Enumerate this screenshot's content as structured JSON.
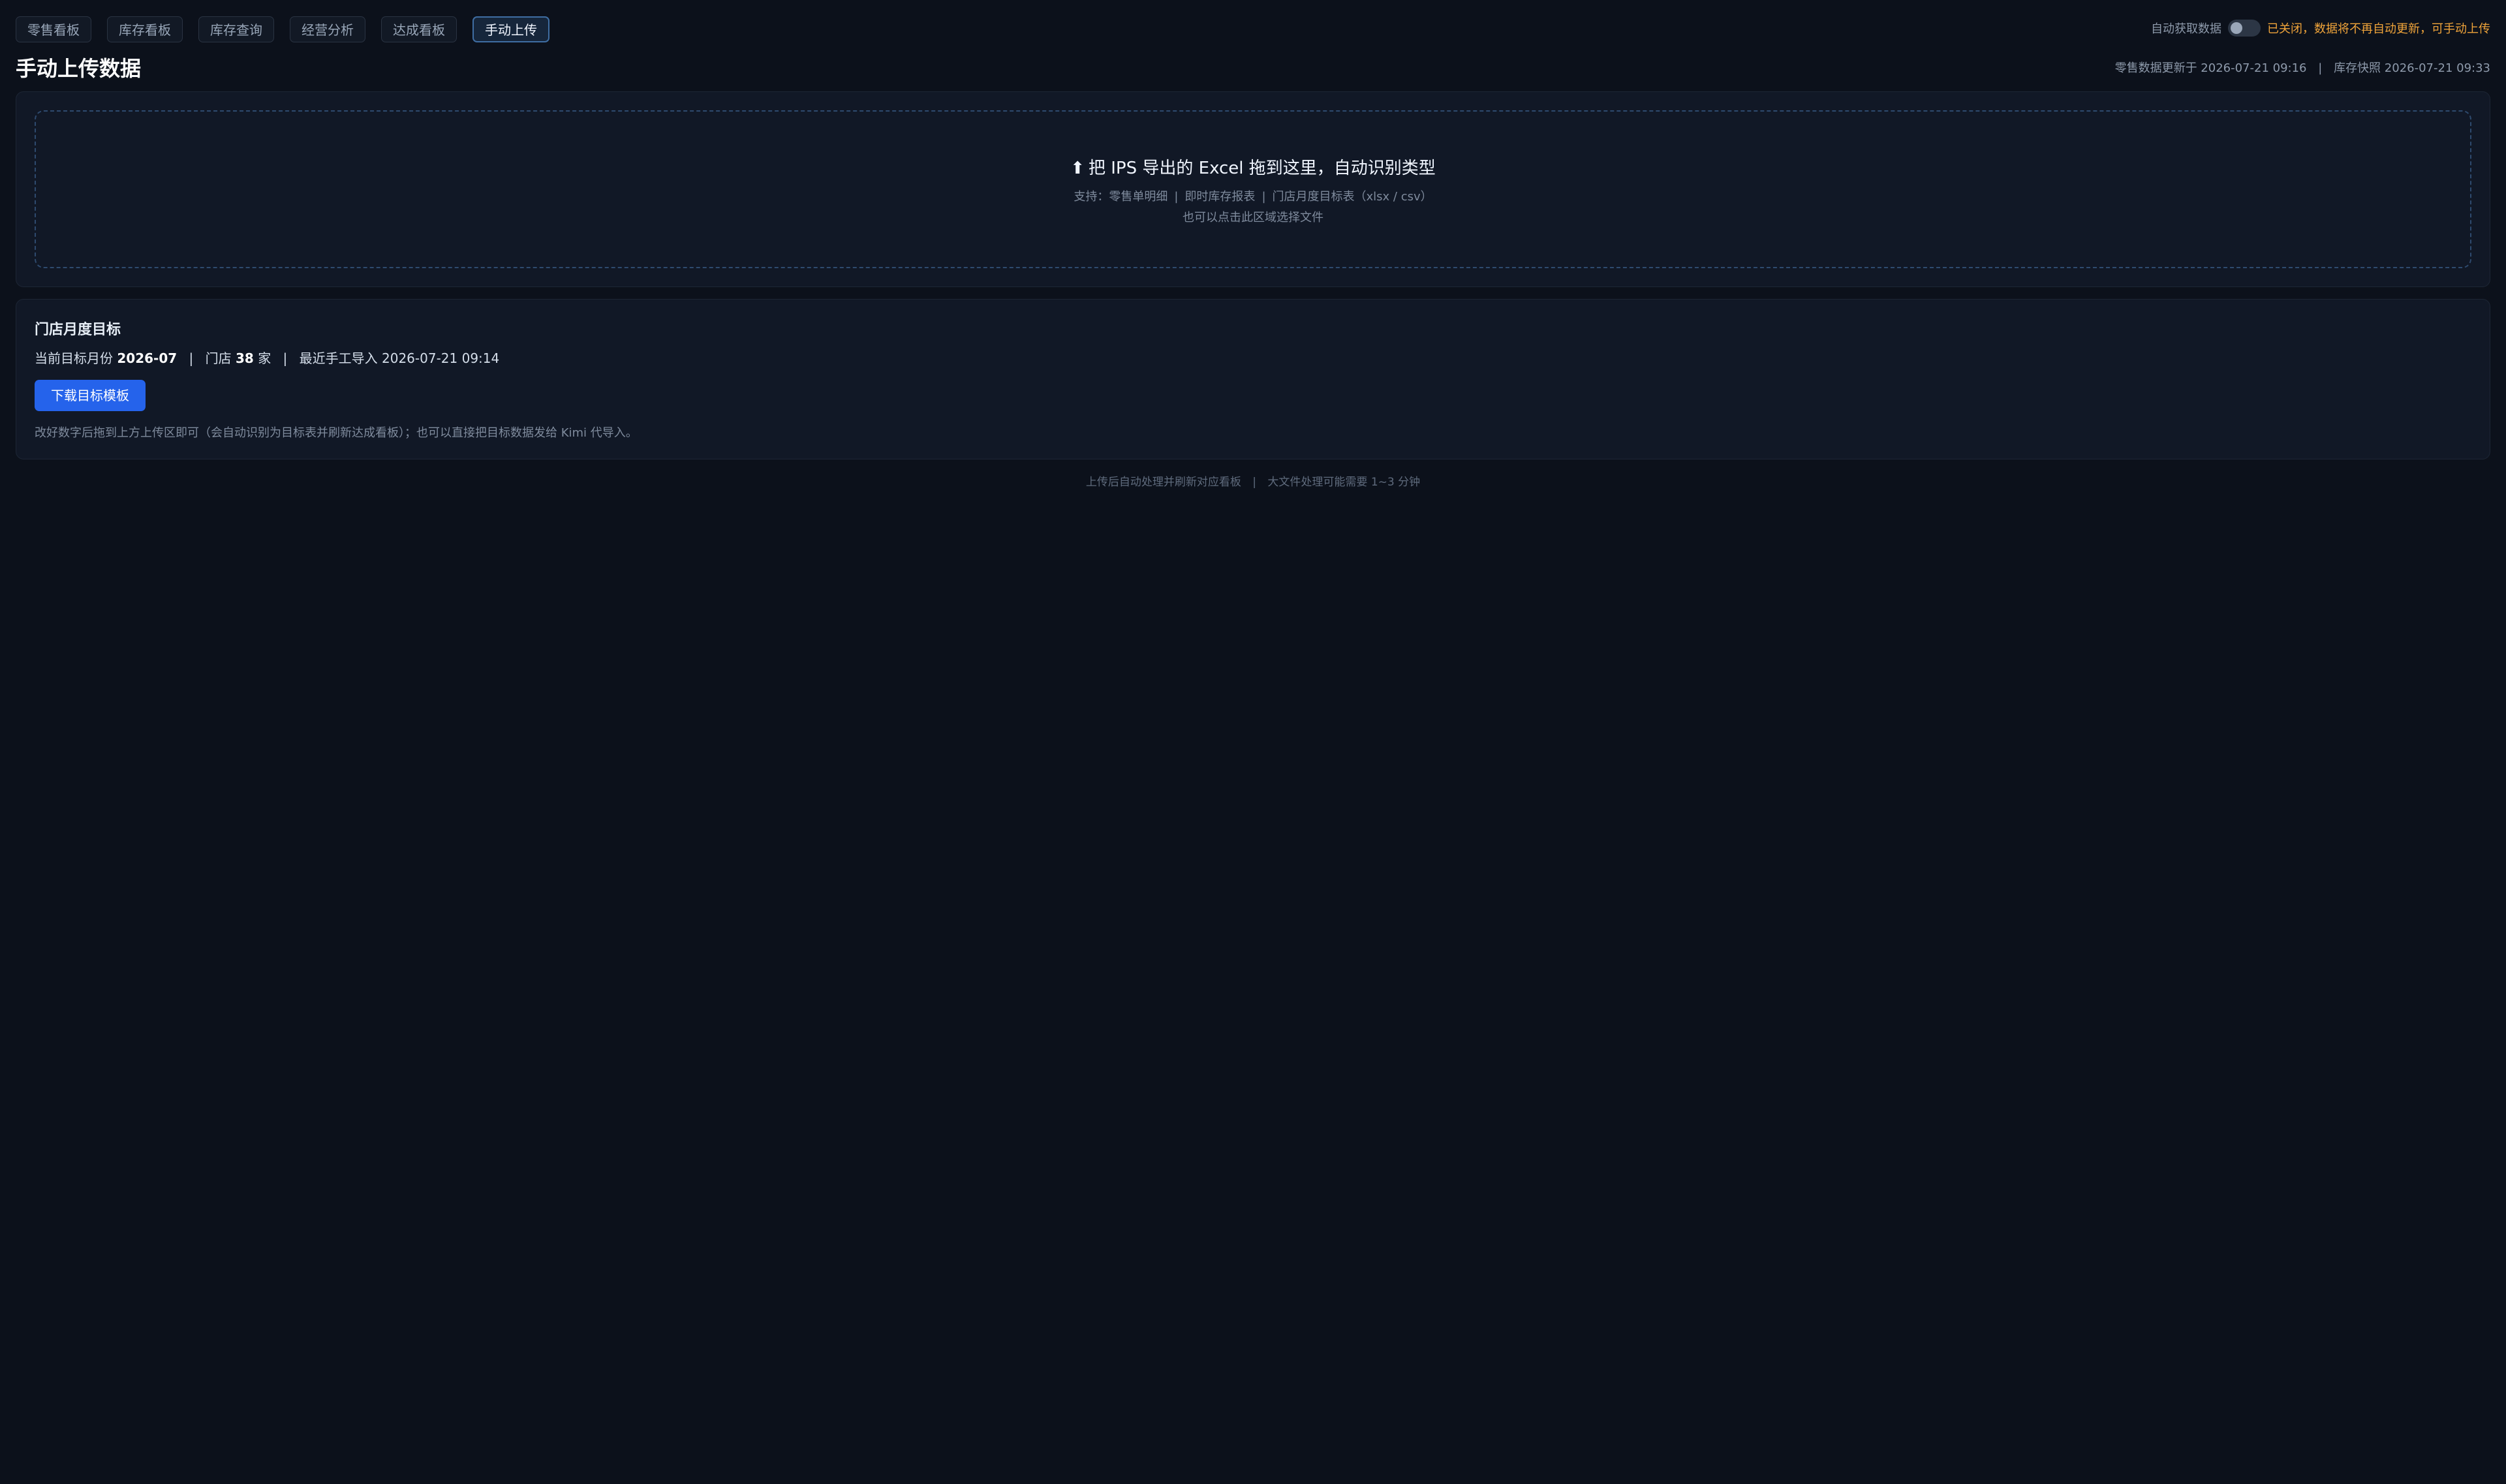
{
  "nav": {
    "tabs": [
      {
        "label": "零售看板",
        "active": false
      },
      {
        "label": "库存看板",
        "active": false
      },
      {
        "label": "库存查询",
        "active": false
      },
      {
        "label": "经营分析",
        "active": false
      },
      {
        "label": "达成看板",
        "active": false
      },
      {
        "label": "手动上传",
        "active": true
      }
    ]
  },
  "auto_fetch": {
    "label": "自动获取数据",
    "enabled": false,
    "status": "已关闭，数据将不再自动更新，可手动上传",
    "status_color": "#f0a43a"
  },
  "page": {
    "title": "手动上传数据",
    "update_info": {
      "retail": "零售数据更新于 2026-07-21 09:16",
      "separator": "|",
      "inventory": "库存快照 2026-07-21 09:33"
    }
  },
  "upload": {
    "icon": "upload-arrow-icon",
    "arrow": "⬆",
    "title": "把 IPS 导出的 Excel 拖到这里，自动识别类型",
    "support_prefix": "支持：",
    "types": [
      "零售单明细",
      "即时库存报表",
      "门店月度目标表（xlsx / csv）"
    ],
    "separator": "|",
    "click_hint": "也可以点击此区域选择文件"
  },
  "target": {
    "title": "门店月度目标",
    "month_label": "当前目标月份",
    "month_value": "2026-07",
    "separator": "|",
    "store_label": "门店",
    "store_count": "38",
    "store_unit": "家",
    "last_import": "最近手工导入 2026-07-21 09:14",
    "download_label": "下载目标模板",
    "download_color": "#2563eb",
    "hint": "改好数字后拖到上方上传区即可（会自动识别为目标表并刷新达成看板）；也可以直接把目标数据发给 Kimi 代导入。"
  },
  "footer": {
    "left": "上传后自动处理并刷新对应看板",
    "separator": "|",
    "right": "大文件处理可能需要 1~3 分钟"
  },
  "colors": {
    "background": "#0c111b",
    "card": "#111826",
    "accent": "#2563eb"
  }
}
